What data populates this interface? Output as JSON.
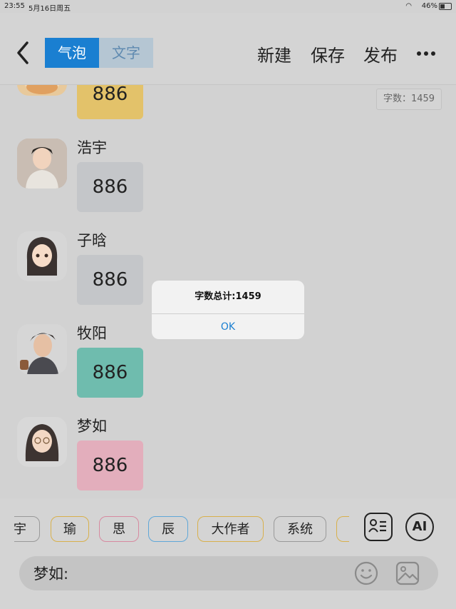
{
  "status": {
    "time": "23:55",
    "date": "5月16日周五",
    "battery": "46%"
  },
  "topbar": {
    "tabs": [
      {
        "label": "气泡"
      },
      {
        "label": "文字"
      }
    ],
    "new_label": "新建",
    "save_label": "保存",
    "publish_label": "发布"
  },
  "wordcount": "字数：1459",
  "chat": [
    {
      "name": "",
      "text": "886",
      "color": "#e3c26a"
    },
    {
      "name": "浩宇",
      "text": "886",
      "color": "#c4c6c9"
    },
    {
      "name": "子晗",
      "text": "886",
      "color": "#c4c6c9"
    },
    {
      "name": "牧阳",
      "text": "886",
      "color": "#6fbcae"
    },
    {
      "name": "梦如",
      "text": "886",
      "color": "#e3aebc"
    }
  ],
  "dialog": {
    "message": "字数总计:1459",
    "ok": "OK"
  },
  "chips": [
    {
      "label": "宇",
      "color": "#999999"
    },
    {
      "label": "瑜",
      "color": "#d8b04c"
    },
    {
      "label": "思",
      "color": "#d78aa0"
    },
    {
      "label": "辰",
      "color": "#5fa7d8"
    },
    {
      "label": "大作者",
      "color": "#d8b04c"
    },
    {
      "label": "系统",
      "color": "#999999"
    },
    {
      "label": "",
      "color": "#d8b04c"
    }
  ],
  "ai_label": "AI",
  "input": {
    "prompt": "梦如:"
  }
}
